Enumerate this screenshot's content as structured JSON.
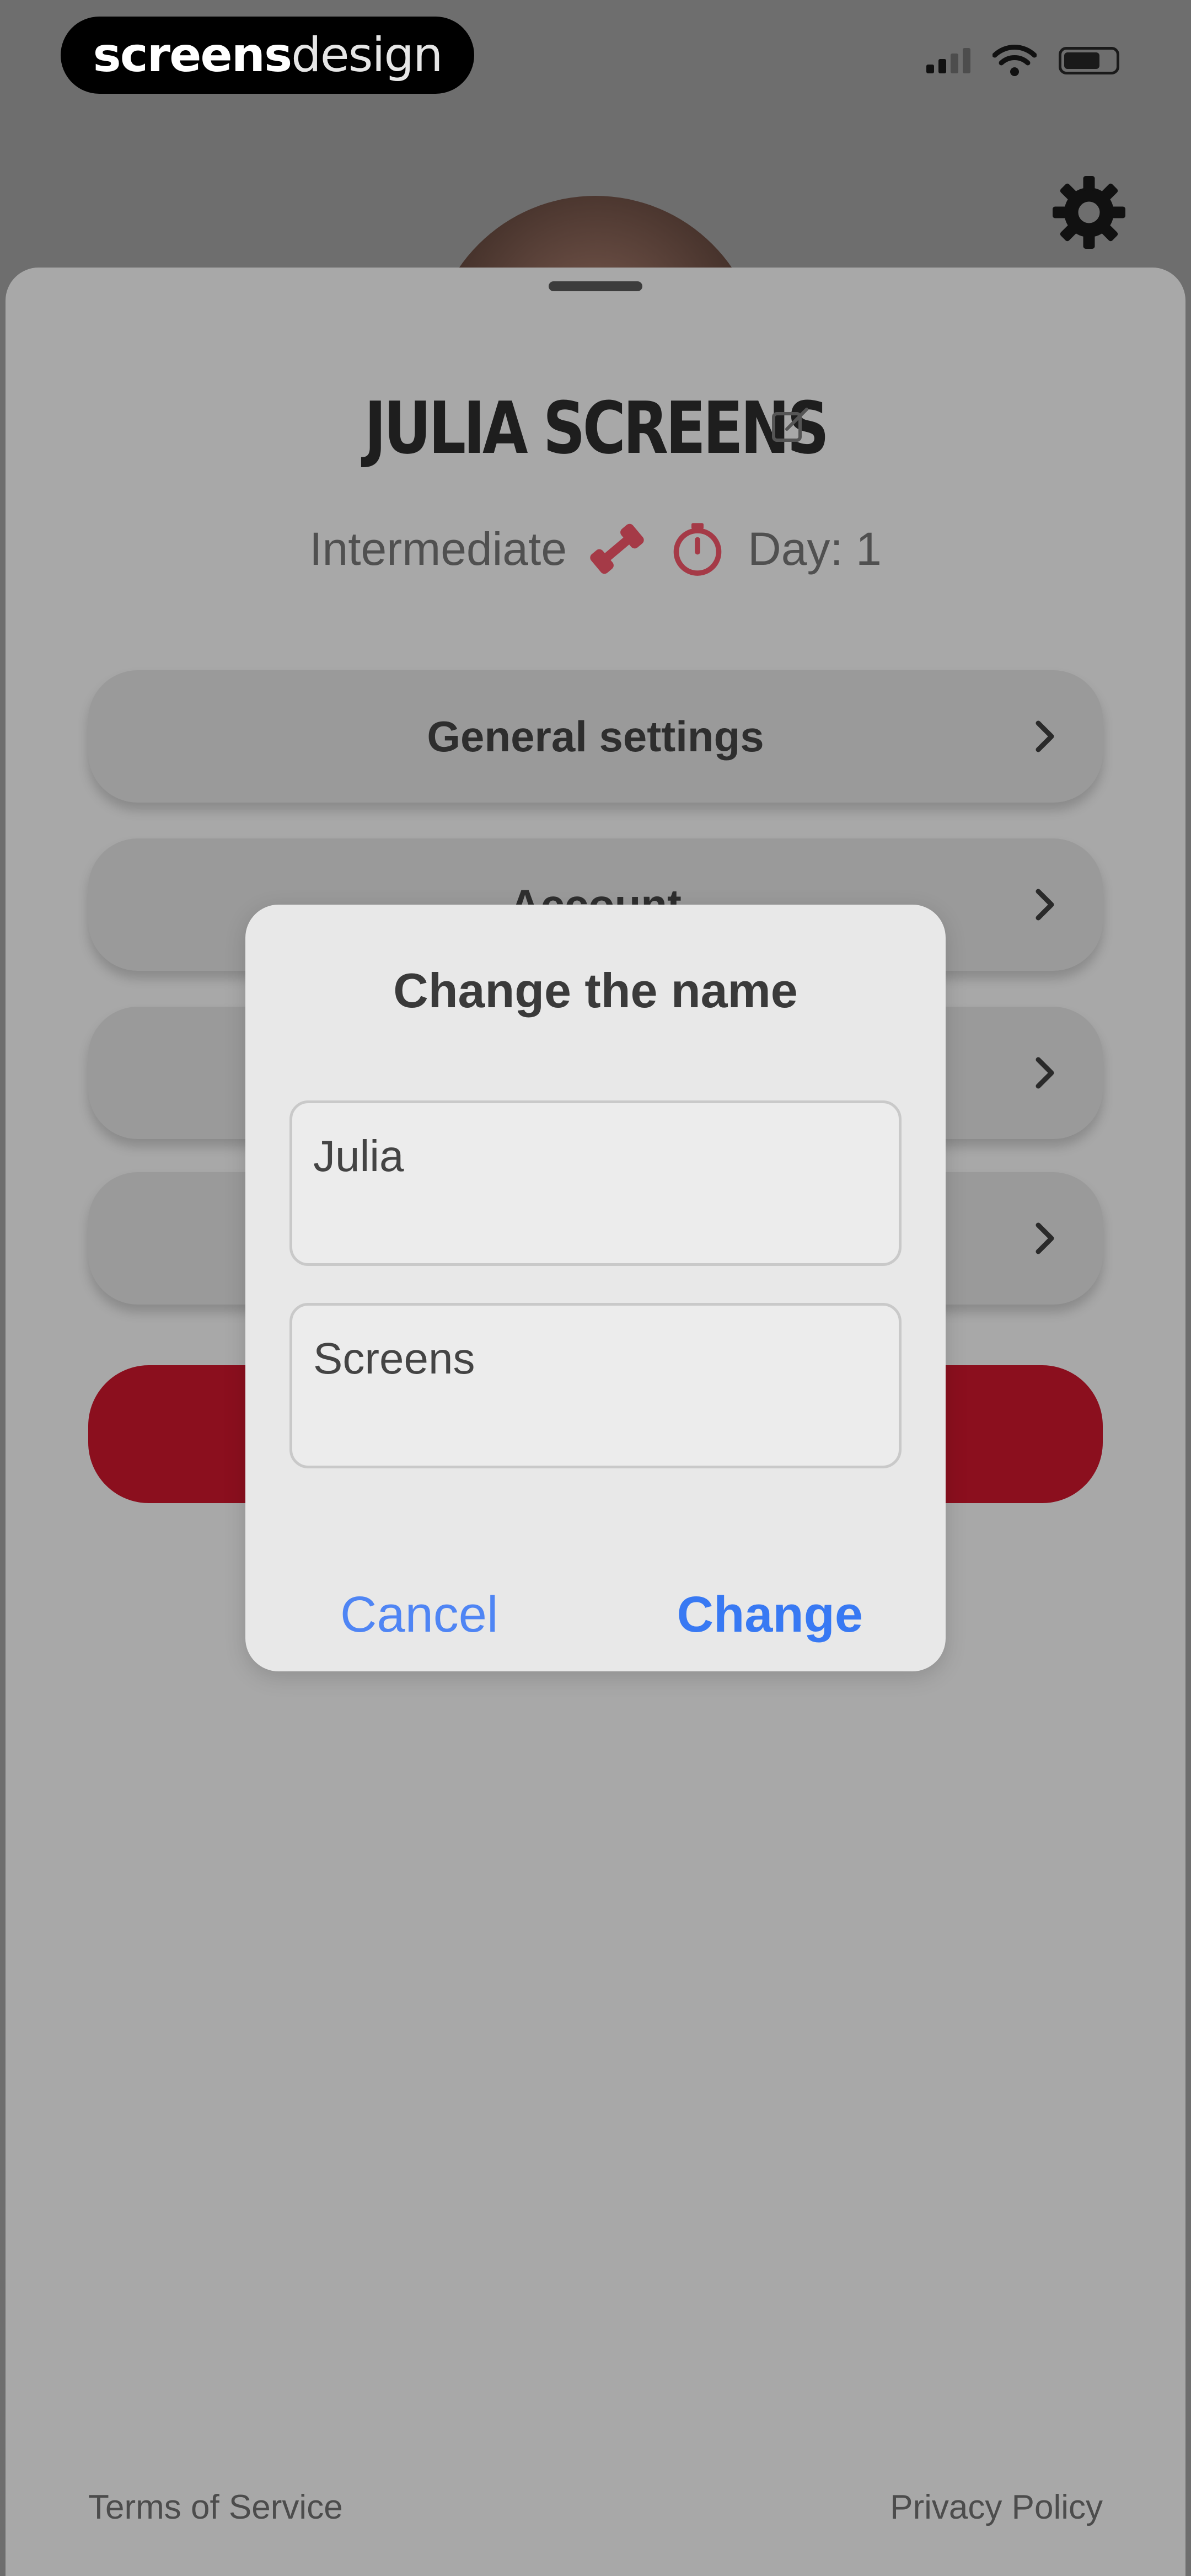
{
  "status_bar": {
    "brand_bold": "screens",
    "brand_light": "design",
    "icons": [
      "signal-icon",
      "wifi-icon",
      "battery-icon"
    ]
  },
  "header": {
    "settings_icon": "gear-icon"
  },
  "profile": {
    "name": "JULIA SCREENS",
    "edit_icon": "edit-icon",
    "level": "Intermediate",
    "level_icon": "dumbbell-icon",
    "day_icon": "timer-icon",
    "day": "Day: 1"
  },
  "menu": {
    "items": [
      {
        "label": "General settings"
      },
      {
        "label": "Account"
      },
      {
        "label": ""
      },
      {
        "label": ""
      }
    ]
  },
  "logout": {
    "label": ""
  },
  "dialog": {
    "title": "Change the name",
    "first_name_value": "Julia",
    "last_name_value": "Screens",
    "cancel_label": "Cancel",
    "change_label": "Change"
  },
  "footer": {
    "terms": "Terms of Service",
    "privacy": "Privacy Policy"
  },
  "colors": {
    "accent_red": "#8b0f1e",
    "ios_blue": "#3879f3"
  }
}
